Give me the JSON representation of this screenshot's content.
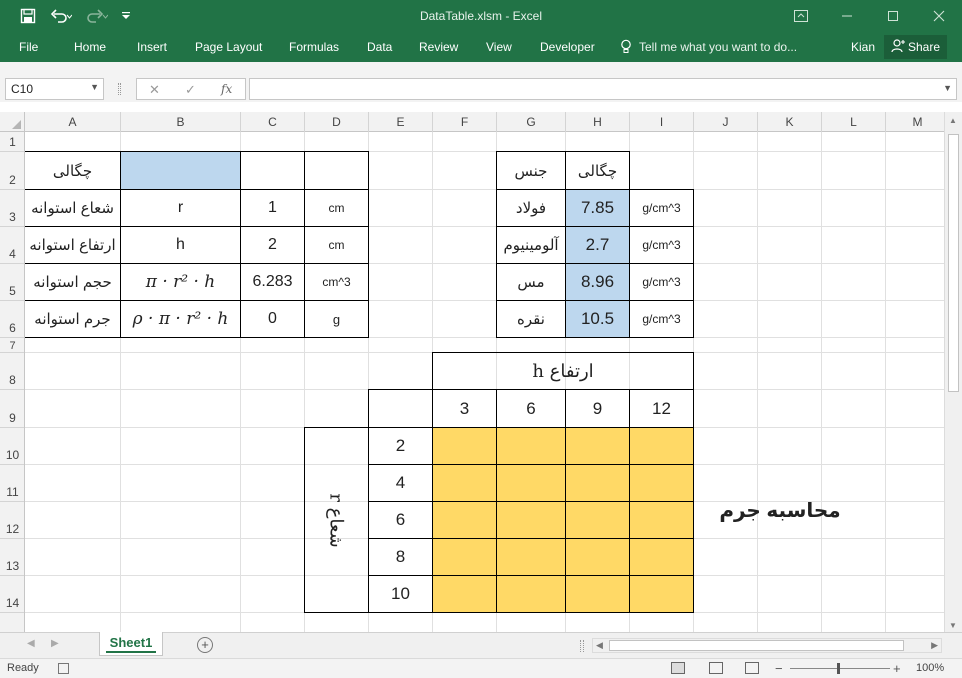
{
  "window": {
    "title": "DataTable.xlsm  -  Excel",
    "qat": {
      "save_icon": "save-icon",
      "undo_icon": "undo-icon",
      "redo_icon": "redo-icon",
      "customize_icon": "customize-icon"
    },
    "controls": {
      "ribbon_display": "ribbon-display-icon",
      "minimize": "minimize-icon",
      "maximize": "maximize-icon",
      "close": "close-icon"
    }
  },
  "ribbon": {
    "tabs": [
      "File",
      "Home",
      "Insert",
      "Page Layout",
      "Formulas",
      "Data",
      "Review",
      "View",
      "Developer"
    ],
    "tell_me": "Tell me what you want to do...",
    "user": "Kian",
    "share": "Share"
  },
  "formula_bar": {
    "name_box": "C10",
    "cancel": "✕",
    "enter": "✓",
    "fx": "fx",
    "content": ""
  },
  "columns": [
    "A",
    "B",
    "C",
    "D",
    "E",
    "F",
    "G",
    "H",
    "I",
    "J",
    "K",
    "L",
    "M"
  ],
  "rows": [
    "1",
    "2",
    "3",
    "4",
    "5",
    "6",
    "7",
    "8",
    "9",
    "10",
    "11",
    "12",
    "13",
    "14"
  ],
  "cells": {
    "a2": "چگالی",
    "a3": "شعاع استوانه",
    "b3": "r",
    "c3": "1",
    "d3": "cm",
    "a4": "ارتفاع استوانه",
    "b4": "h",
    "c4": "2",
    "d4": "cm",
    "a5": "حجم استوانه",
    "b5": "π · r² · h",
    "c5": "6.283",
    "d5": "cm^3",
    "a6": "جرم استوانه",
    "b6": "ρ · π · r² · h",
    "c6": "0",
    "d6": "g",
    "g2": "جنس",
    "h2": "چگالی",
    "g3": "فولاد",
    "h3": "7.85",
    "i3": "g/cm^3",
    "g4": "آلومینیوم",
    "h4": "2.7",
    "i4": "g/cm^3",
    "g5": "مس",
    "h5": "8.96",
    "i5": "g/cm^3",
    "g6": "نقره",
    "h6": "10.5",
    "i6": "g/cm^3",
    "height_label": "ارتفاع h",
    "radius_label": "شعاع r",
    "mass_calc": "محاسبه جرم"
  },
  "data_table": {
    "heights": [
      "3",
      "6",
      "9",
      "12"
    ],
    "radii": [
      "2",
      "4",
      "6",
      "8",
      "10"
    ]
  },
  "sheet_tabs": {
    "active": "Sheet1",
    "add": "+"
  },
  "status": {
    "ready": "Ready",
    "zoom_out": "−",
    "zoom_in": "+",
    "zoom": "100%"
  },
  "colors": {
    "excel_green": "#217346",
    "input_blue": "#bdd7ee",
    "table_gold": "#ffd966"
  }
}
